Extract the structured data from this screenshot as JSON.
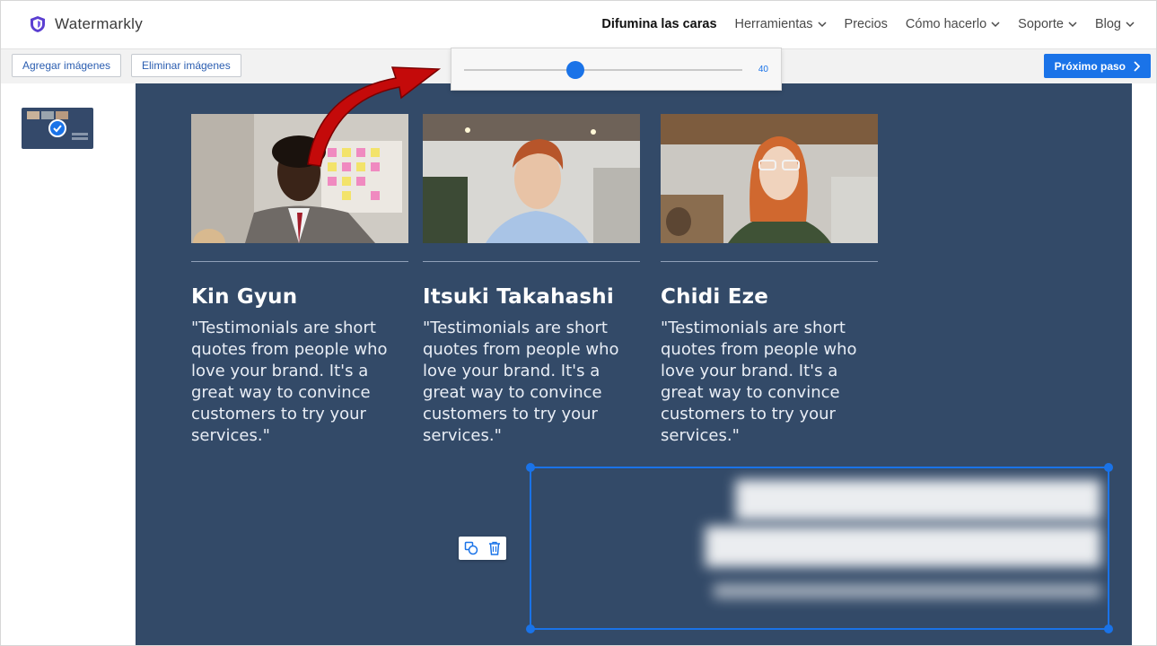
{
  "app": {
    "name": "Watermarkly",
    "accent": "#1a73e8",
    "canvas_bg": "#334a68"
  },
  "nav": {
    "items": [
      {
        "label": "Difumina las caras",
        "active": true,
        "dropdown": false
      },
      {
        "label": "Herramientas",
        "active": false,
        "dropdown": true
      },
      {
        "label": "Precios",
        "active": false,
        "dropdown": false
      },
      {
        "label": "Cómo hacerlo",
        "active": false,
        "dropdown": true
      },
      {
        "label": "Soporte",
        "active": false,
        "dropdown": true
      },
      {
        "label": "Blog",
        "active": false,
        "dropdown": true
      }
    ]
  },
  "toolbar": {
    "add_label": "Agregar imágenes",
    "remove_label": "Eliminar imágenes",
    "next_label": "Próximo paso"
  },
  "slider": {
    "value": "40",
    "min": 0,
    "max": 100
  },
  "cards": [
    {
      "name": "Kin Gyun",
      "quote": "\"Testimonials are short quotes from people who love your brand. It's a great way to convince customers to try your services.\""
    },
    {
      "name": "Itsuki Takahashi",
      "quote": "\"Testimonials are short quotes from people who love your brand. It's a great way to convince customers to try your services.\""
    },
    {
      "name": "Chidi Eze",
      "quote": "\"Testimonials are short quotes from people who love your brand. It's a great way to convince customers to try your services.\""
    }
  ]
}
